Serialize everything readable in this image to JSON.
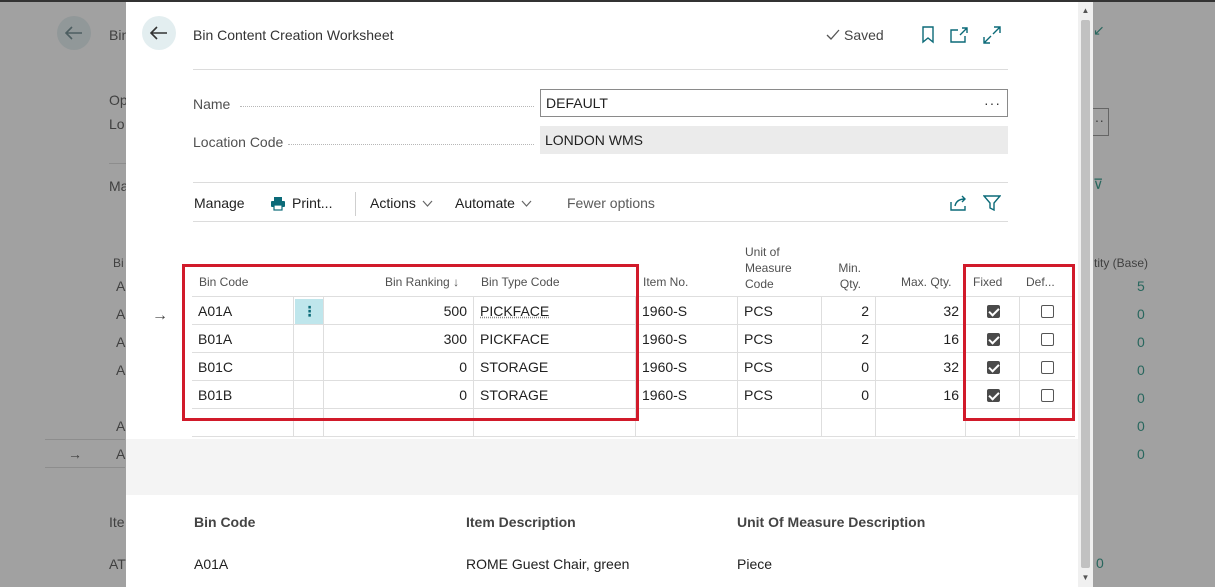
{
  "background": {
    "title_fragment": "Bin",
    "labels": [
      "Op",
      "Lo",
      "Ma",
      "Ite",
      "AT"
    ],
    "column_header": "tity (Base)",
    "row_letters": [
      "A",
      "A",
      "A",
      "A",
      "A",
      "A"
    ],
    "values": [
      "5",
      "0",
      "0",
      "0",
      "0",
      "0",
      "0"
    ],
    "dots": "···"
  },
  "dialog": {
    "title": "Bin Content Creation Worksheet",
    "saved_label": "Saved",
    "fields": {
      "name_label": "Name",
      "name_value": "DEFAULT",
      "name_dots": "···",
      "location_label": "Location Code",
      "location_value": "LONDON WMS"
    },
    "actions": {
      "manage": "Manage",
      "print": "Print...",
      "actions": "Actions",
      "automate": "Automate",
      "fewer_options": "Fewer options"
    },
    "grid": {
      "headers": {
        "bin_code": "Bin Code",
        "bin_ranking": "Bin Ranking",
        "bin_type_code": "Bin Type Code",
        "item_no": "Item No.",
        "uom_line1": "Unit of",
        "uom_line2": "Measure",
        "uom_line3": "Code",
        "min_line1": "Min.",
        "min_line2": "Qty.",
        "max_qty": "Max. Qty.",
        "fixed": "Fixed",
        "default": "Def..."
      },
      "rows": [
        {
          "bin_code": "A01A",
          "bin_ranking": "500",
          "bin_type_code": "PICKFACE",
          "item_no": "1960-S",
          "uom": "PCS",
          "min_qty": "2",
          "max_qty": "32",
          "fixed": true,
          "default": false
        },
        {
          "bin_code": "B01A",
          "bin_ranking": "300",
          "bin_type_code": "PICKFACE",
          "item_no": "1960-S",
          "uom": "PCS",
          "min_qty": "2",
          "max_qty": "16",
          "fixed": true,
          "default": false
        },
        {
          "bin_code": "B01C",
          "bin_ranking": "0",
          "bin_type_code": "STORAGE",
          "item_no": "1960-S",
          "uom": "PCS",
          "min_qty": "0",
          "max_qty": "32",
          "fixed": true,
          "default": false
        },
        {
          "bin_code": "B01B",
          "bin_ranking": "0",
          "bin_type_code": "STORAGE",
          "item_no": "1960-S",
          "uom": "PCS",
          "min_qty": "0",
          "max_qty": "16",
          "fixed": true,
          "default": false
        }
      ]
    },
    "factbox": {
      "headers": {
        "bin_code": "Bin Code",
        "item_description": "Item Description",
        "uom_description": "Unit Of Measure Description"
      },
      "values": {
        "bin_code": "A01A",
        "item_description": "ROME Guest Chair, green",
        "uom_description": "Piece"
      }
    }
  },
  "colors": {
    "accent": "#0b6a78",
    "highlight": "#d11a2a",
    "selected_cell": "#bfe6ec"
  }
}
